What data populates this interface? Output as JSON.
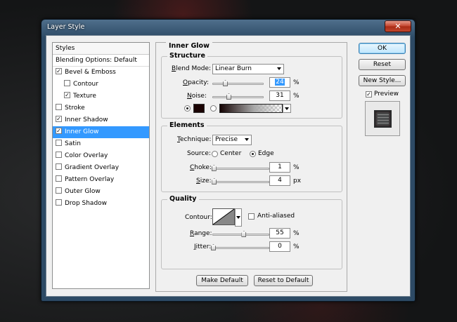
{
  "window": {
    "title": "Layer Style",
    "close_label": "✕"
  },
  "styles_panel": {
    "header": "Styles",
    "blending_options": "Blending Options: Default",
    "items": [
      {
        "label": "Bevel & Emboss",
        "checked": true,
        "indent": false,
        "selected": false
      },
      {
        "label": "Contour",
        "checked": false,
        "indent": true,
        "selected": false
      },
      {
        "label": "Texture",
        "checked": true,
        "indent": true,
        "selected": false
      },
      {
        "label": "Stroke",
        "checked": false,
        "indent": false,
        "selected": false
      },
      {
        "label": "Inner Shadow",
        "checked": true,
        "indent": false,
        "selected": false
      },
      {
        "label": "Inner Glow",
        "checked": true,
        "indent": false,
        "selected": true
      },
      {
        "label": "Satin",
        "checked": false,
        "indent": false,
        "selected": false
      },
      {
        "label": "Color Overlay",
        "checked": false,
        "indent": false,
        "selected": false
      },
      {
        "label": "Gradient Overlay",
        "checked": false,
        "indent": false,
        "selected": false
      },
      {
        "label": "Pattern Overlay",
        "checked": false,
        "indent": false,
        "selected": false
      },
      {
        "label": "Outer Glow",
        "checked": false,
        "indent": false,
        "selected": false
      },
      {
        "label": "Drop Shadow",
        "checked": false,
        "indent": false,
        "selected": false
      }
    ]
  },
  "inner_glow": {
    "title": "Inner Glow",
    "structure": {
      "legend": "Structure",
      "blend_mode_label": "Blend Mode:",
      "blend_mode_value": "Linear Burn",
      "opacity_label": "Opacity:",
      "opacity_value": "24",
      "opacity_unit": "%",
      "opacity_level": 0.24,
      "noise_label": "Noise:",
      "noise_value": "31",
      "noise_unit": "%",
      "noise_level": 0.31,
      "color_swatch": "#1a0303"
    },
    "elements": {
      "legend": "Elements",
      "technique_label": "Technique:",
      "technique_value": "Precise",
      "source_label": "Source:",
      "source_center": "Center",
      "source_edge": "Edge",
      "source_selected": "Edge",
      "choke_label": "Choke:",
      "choke_value": "1",
      "choke_unit": "%",
      "choke_level": 0.01,
      "size_label": "Size:",
      "size_value": "4",
      "size_unit": "px",
      "size_level": 0.016
    },
    "quality": {
      "legend": "Quality",
      "contour_label": "Contour:",
      "anti_aliased_label": "Anti-aliased",
      "anti_aliased_checked": false,
      "range_label": "Range:",
      "range_value": "55",
      "range_unit": "%",
      "range_level": 0.55,
      "jitter_label": "Jitter:",
      "jitter_value": "0",
      "jitter_unit": "%",
      "jitter_level": 0.0
    },
    "make_default": "Make Default",
    "reset_to_default": "Reset to Default"
  },
  "buttons": {
    "ok": "OK",
    "reset": "Reset",
    "new_style": "New Style...",
    "preview_label": "Preview",
    "preview_checked": true
  }
}
